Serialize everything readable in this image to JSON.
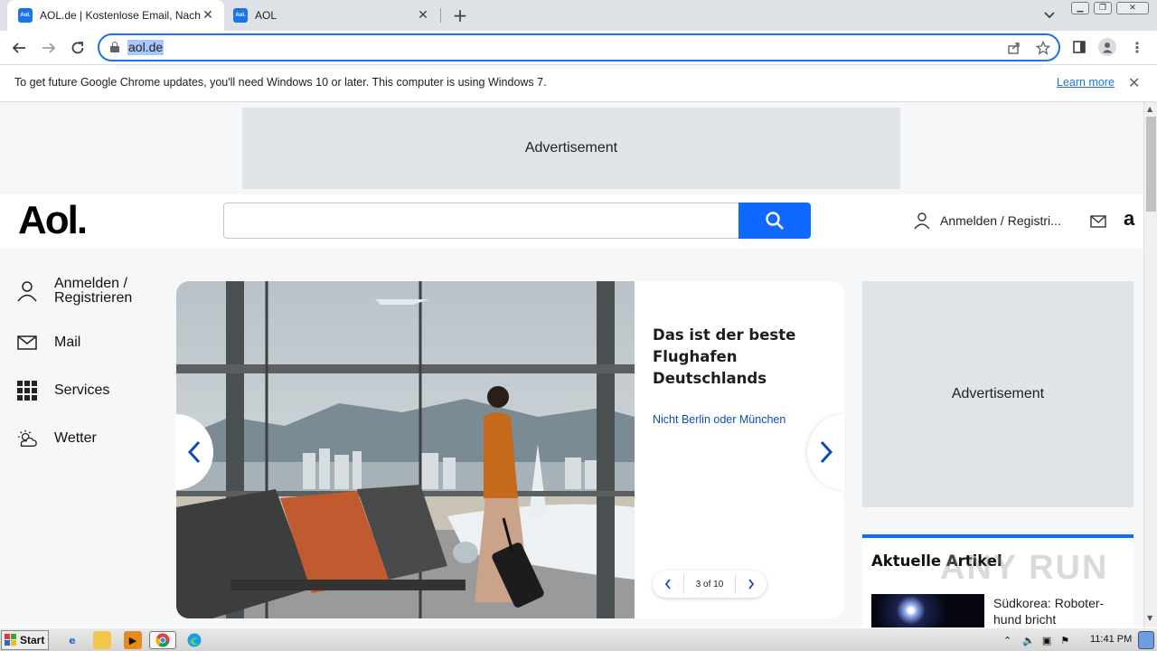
{
  "browser": {
    "tabs": [
      {
        "label": "AOL.de | Kostenlose Email, Nachrichten",
        "favicon": "Aol."
      },
      {
        "label": "AOL",
        "favicon": "Aol."
      }
    ],
    "url": "aol.de",
    "infobar": {
      "message": "To get future Google Chrome updates, you'll need Windows 10 or later. This computer is using Windows 7.",
      "link": "Learn more"
    }
  },
  "page": {
    "ad_top": "Advertisement",
    "logo": "Aol.",
    "search_placeholder": "",
    "header_user": "Anmelden / Registri...",
    "amazon": "a",
    "sidebar": [
      {
        "label": "Anmelden / Registrieren",
        "icon": "user-icon"
      },
      {
        "label": "Mail",
        "icon": "mail-icon"
      },
      {
        "label": "Services",
        "icon": "grid-icon"
      },
      {
        "label": "Wetter",
        "icon": "weather-icon"
      }
    ],
    "carousel": {
      "title": "Das ist der beste Flughafen Deutschlands",
      "subtitle": "Nicht Berlin oder München",
      "pager": "3 of 10"
    },
    "ad_side": "Advertisement",
    "articles": {
      "heading": "Aktuelle Artikel",
      "items": [
        {
          "title": "Südkorea: Roboter-hund bricht"
        }
      ]
    },
    "watermark": "ANY RUN"
  },
  "taskbar": {
    "start": "Start",
    "clock": "11:41 PM"
  },
  "colors": {
    "accent": "#0f69ff",
    "link": "#0f4ac0",
    "chrome_focus": "#1a73e8"
  }
}
